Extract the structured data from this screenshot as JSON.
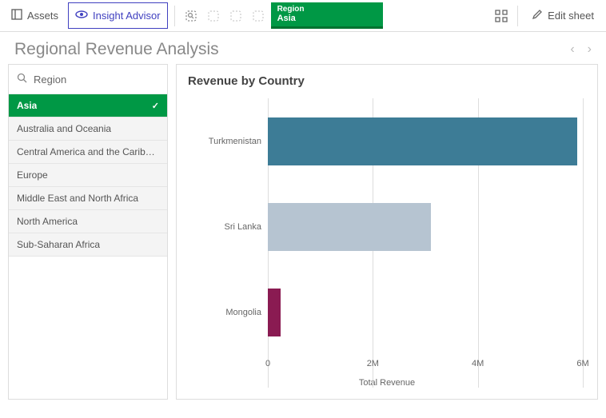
{
  "toolbar": {
    "assets": "Assets",
    "insight": "Insight Advisor",
    "edit": "Edit sheet",
    "filter_label": "Region",
    "filter_value": "Asia"
  },
  "header": {
    "title": "Regional Revenue Analysis"
  },
  "filter": {
    "field": "Region",
    "items": [
      {
        "label": "Asia",
        "selected": true
      },
      {
        "label": "Australia and Oceania",
        "selected": false
      },
      {
        "label": "Central America and the Carib…",
        "selected": false
      },
      {
        "label": "Europe",
        "selected": false
      },
      {
        "label": "Middle East and North Africa",
        "selected": false
      },
      {
        "label": "North America",
        "selected": false
      },
      {
        "label": "Sub-Saharan Africa",
        "selected": false
      }
    ]
  },
  "chart_title": "Revenue by Country",
  "chart_data": {
    "type": "bar",
    "orientation": "horizontal",
    "categories": [
      "Turkmenistan",
      "Sri Lanka",
      "Mongolia"
    ],
    "values": [
      5900000,
      3100000,
      250000
    ],
    "colors": [
      "#3d7c96",
      "#b6c4d1",
      "#8a1b52"
    ],
    "title": "Revenue by Country",
    "xlabel": "Total Revenue",
    "ylabel": "",
    "xlim": [
      0,
      6000000
    ],
    "x_ticks": [
      0,
      2000000,
      4000000,
      6000000
    ],
    "x_tick_labels": [
      "0",
      "2M",
      "4M",
      "6M"
    ]
  }
}
